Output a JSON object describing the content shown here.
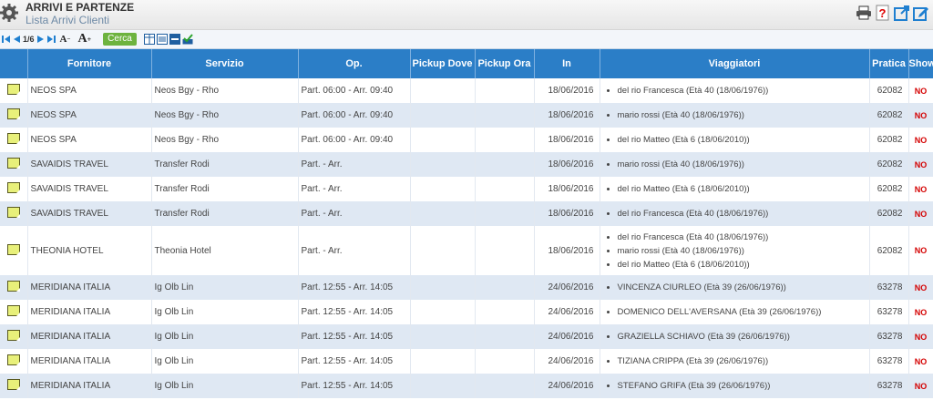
{
  "header": {
    "title": "ARRIVI E PARTENZE",
    "subtitle": "Lista Arrivi Clienti"
  },
  "toolbar": {
    "page_indicator": "1/6",
    "search_label": "Cerca"
  },
  "columns": [
    "Fornitore",
    "Servizio",
    "Op.",
    "Pickup Dove",
    "Pickup Ora",
    "In",
    "Viaggiatori",
    "Pratica",
    "Show"
  ],
  "rows": [
    {
      "fornitore": "NEOS SPA",
      "servizio": "Neos Bgy - Rho",
      "op": "Part. 06:00 - Arr. 09:40",
      "dove": "",
      "ora": "",
      "in": "18/06/2016",
      "viaggiatori": [
        "del rio Francesca (Età 40 (18/06/1976))"
      ],
      "pratica": "62082",
      "show": "NO"
    },
    {
      "fornitore": "NEOS SPA",
      "servizio": "Neos Bgy - Rho",
      "op": "Part. 06:00 - Arr. 09:40",
      "dove": "",
      "ora": "",
      "in": "18/06/2016",
      "viaggiatori": [
        "mario rossi (Età 40 (18/06/1976))"
      ],
      "pratica": "62082",
      "show": "NO"
    },
    {
      "fornitore": "NEOS SPA",
      "servizio": "Neos Bgy - Rho",
      "op": "Part. 06:00 - Arr. 09:40",
      "dove": "",
      "ora": "",
      "in": "18/06/2016",
      "viaggiatori": [
        "del rio Matteo (Età 6 (18/06/2010))"
      ],
      "pratica": "62082",
      "show": "NO"
    },
    {
      "fornitore": "SAVAIDIS TRAVEL",
      "servizio": "Transfer Rodi",
      "op": "Part. - Arr.",
      "dove": "",
      "ora": "",
      "in": "18/06/2016",
      "viaggiatori": [
        "mario rossi (Età 40 (18/06/1976))"
      ],
      "pratica": "62082",
      "show": "NO"
    },
    {
      "fornitore": "SAVAIDIS TRAVEL",
      "servizio": "Transfer Rodi",
      "op": "Part. - Arr.",
      "dove": "",
      "ora": "",
      "in": "18/06/2016",
      "viaggiatori": [
        "del rio Matteo (Età 6 (18/06/2010))"
      ],
      "pratica": "62082",
      "show": "NO"
    },
    {
      "fornitore": "SAVAIDIS TRAVEL",
      "servizio": "Transfer Rodi",
      "op": "Part. - Arr.",
      "dove": "",
      "ora": "",
      "in": "18/06/2016",
      "viaggiatori": [
        "del rio Francesca (Età 40 (18/06/1976))"
      ],
      "pratica": "62082",
      "show": "NO"
    },
    {
      "fornitore": "THEONIA HOTEL",
      "servizio": "Theonia Hotel",
      "op": "Part. - Arr.",
      "dove": "",
      "ora": "",
      "in": "18/06/2016",
      "viaggiatori": [
        "del rio Francesca (Età 40 (18/06/1976))",
        "mario rossi (Età 40 (18/06/1976))",
        "del rio Matteo (Età 6 (18/06/2010))"
      ],
      "pratica": "62082",
      "show": "NO"
    },
    {
      "fornitore": "MERIDIANA ITALIA",
      "servizio": "Ig Olb Lin",
      "op": "Part. 12:55 - Arr. 14:05",
      "dove": "",
      "ora": "",
      "in": "24/06/2016",
      "viaggiatori": [
        "VINCENZA CIURLEO (Età 39 (26/06/1976))"
      ],
      "pratica": "63278",
      "show": "NO"
    },
    {
      "fornitore": "MERIDIANA ITALIA",
      "servizio": "Ig Olb Lin",
      "op": "Part. 12:55 - Arr. 14:05",
      "dove": "",
      "ora": "",
      "in": "24/06/2016",
      "viaggiatori": [
        "DOMENICO DELL'AVERSANA (Età 39 (26/06/1976))"
      ],
      "pratica": "63278",
      "show": "NO"
    },
    {
      "fornitore": "MERIDIANA ITALIA",
      "servizio": "Ig Olb Lin",
      "op": "Part. 12:55 - Arr. 14:05",
      "dove": "",
      "ora": "",
      "in": "24/06/2016",
      "viaggiatori": [
        "GRAZIELLA SCHIAVO (Età 39 (26/06/1976))"
      ],
      "pratica": "63278",
      "show": "NO"
    },
    {
      "fornitore": "MERIDIANA ITALIA",
      "servizio": "Ig Olb Lin",
      "op": "Part. 12:55 - Arr. 14:05",
      "dove": "",
      "ora": "",
      "in": "24/06/2016",
      "viaggiatori": [
        "TIZIANA CRIPPA (Età 39 (26/06/1976))"
      ],
      "pratica": "63278",
      "show": "NO"
    },
    {
      "fornitore": "MERIDIANA ITALIA",
      "servizio": "Ig Olb Lin",
      "op": "Part. 12:55 - Arr. 14:05",
      "dove": "",
      "ora": "",
      "in": "24/06/2016",
      "viaggiatori": [
        "STEFANO GRIFA (Età 39 (26/06/1976))"
      ],
      "pratica": "63278",
      "show": "NO"
    }
  ]
}
